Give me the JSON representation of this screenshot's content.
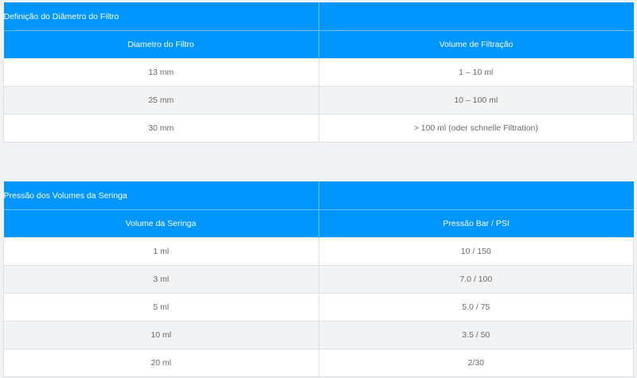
{
  "filter_table": {
    "title": "Definição do Diâmetro do Filtro",
    "headers": [
      "Diametro do Filtro",
      "Volume de Filtração"
    ],
    "rows": [
      [
        "13 mm",
        "1 – 10 ml"
      ],
      [
        "25 mm",
        "10 – 100 ml"
      ],
      [
        "30 mm",
        "> 100 ml (oder schnelle Filtration)"
      ]
    ]
  },
  "syringe_table": {
    "title": "Pressão dos Volumes da Seringa",
    "headers": [
      "Volume da Seringa",
      "Pressão Bar / PSI"
    ],
    "rows": [
      [
        "1 ml",
        "10 / 150"
      ],
      [
        "3 ml",
        "7.0 / 100"
      ],
      [
        "5 ml",
        "5.0 / 75"
      ],
      [
        "10 ml",
        "3.5 / 50"
      ],
      [
        "20 ml",
        "2/30"
      ]
    ]
  },
  "colors": {
    "header_blue": "#0096ff",
    "row_alt": "#f2f3f4",
    "page_bg": "#f0f2f4"
  }
}
